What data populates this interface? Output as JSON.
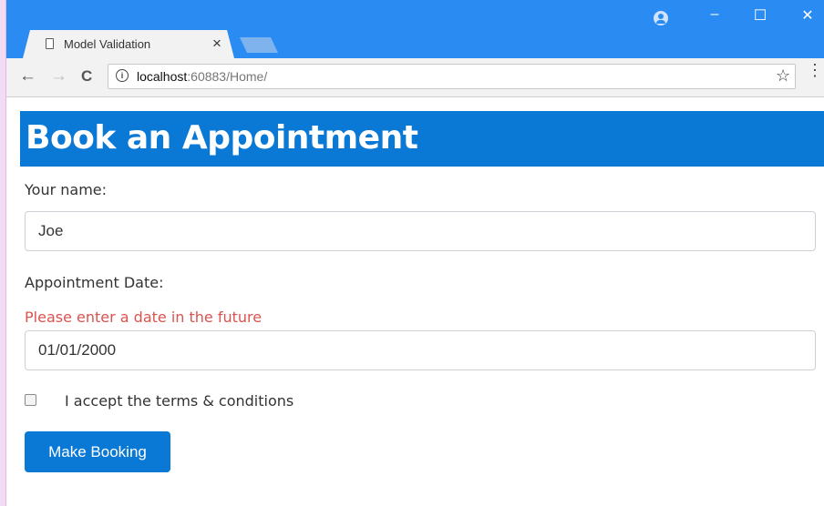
{
  "browser": {
    "tab_title": "Model Validation",
    "tab_close": "×",
    "url_host": "localhost",
    "url_rest": ":60883/Home/",
    "win_minimize": "–",
    "win_maximize": "☐",
    "win_close": "✕",
    "back": "←",
    "forward": "→",
    "reload": "C",
    "info": "i",
    "star": "☆",
    "menu": "⋮",
    "accent": "#2a8bf2"
  },
  "page": {
    "heading": "Book an Appointment",
    "name_label": "Your name:",
    "name_value": "Joe",
    "date_label": "Appointment Date:",
    "date_error": "Please enter a date in the future",
    "date_value": "01/01/2000",
    "terms_label": "I accept the terms & conditions",
    "terms_checked": false,
    "submit_label": "Make Booking",
    "brand_color": "#0a79d6",
    "error_color": "#d9534f"
  }
}
